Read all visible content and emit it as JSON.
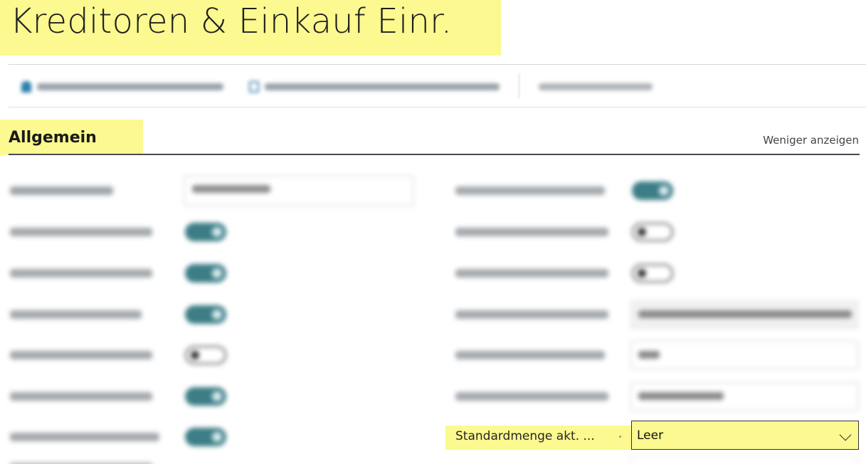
{
  "page": {
    "title": "Kreditoren & Einkauf Einr."
  },
  "colors": {
    "highlight": "#fbf98f",
    "toggle_on": "#3c7d86",
    "section_rule": "#4a4a55"
  },
  "section": {
    "title": "Allgemein",
    "show_less": "Weniger anzeigen"
  },
  "fields": {
    "standard_quantity": {
      "label": "Standardmenge akt. ...",
      "value": "Leer"
    }
  }
}
